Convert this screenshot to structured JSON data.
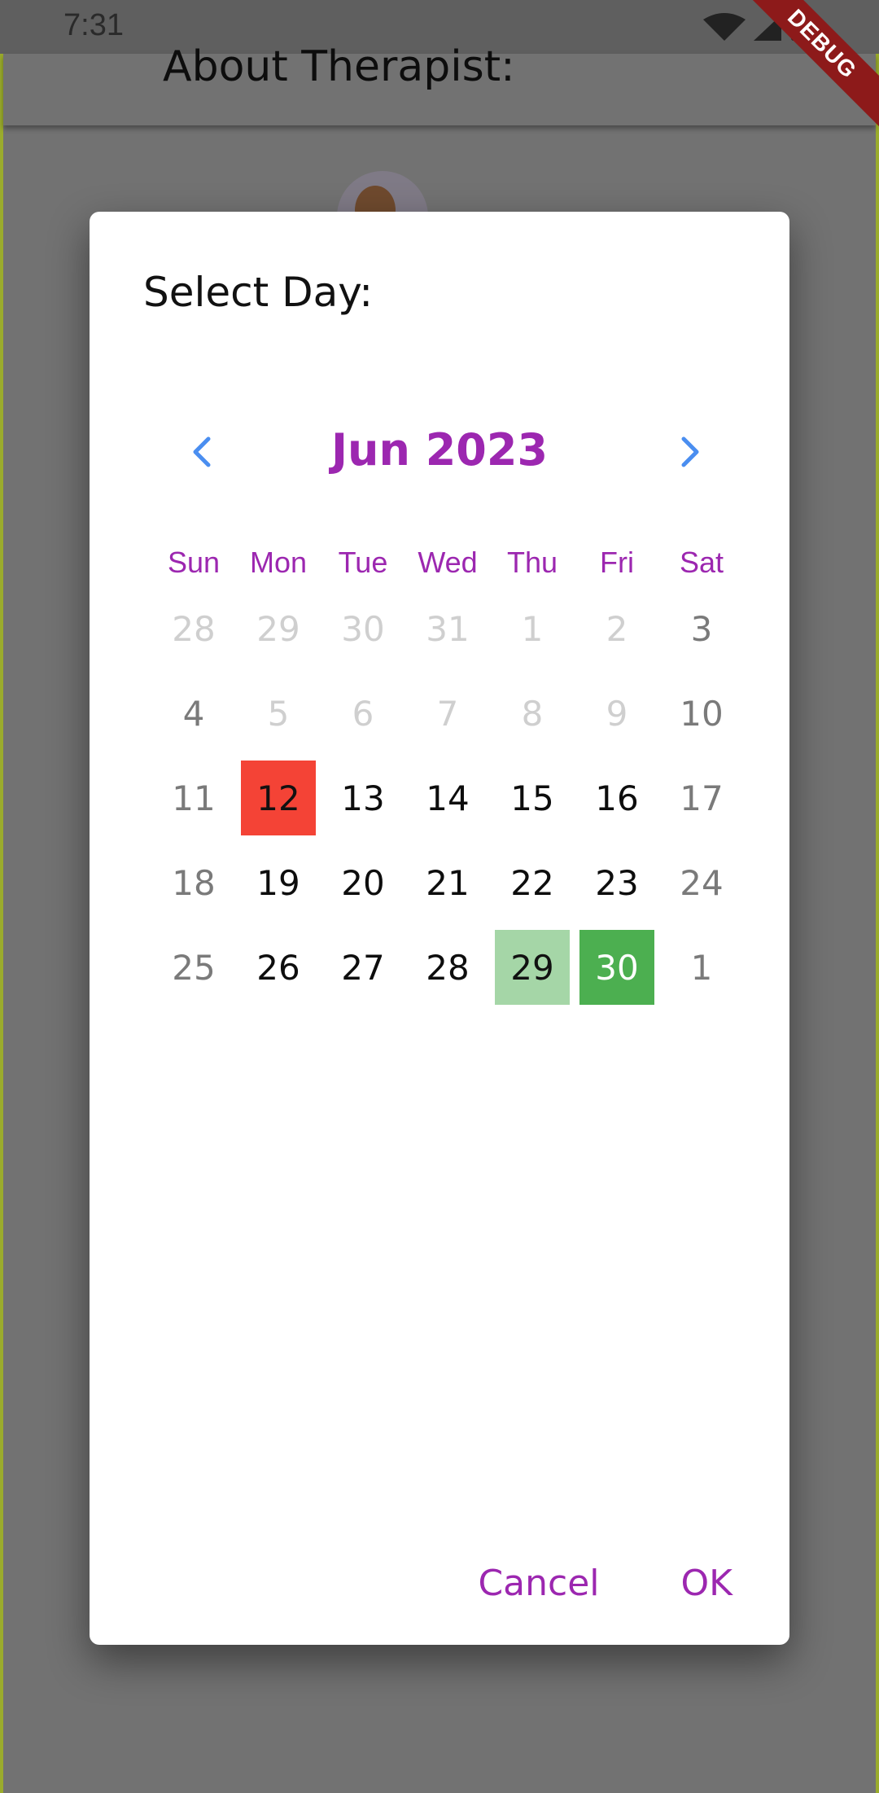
{
  "status_bar": {
    "time": "7:31"
  },
  "app_bar": {
    "title": "About Therapist:"
  },
  "debug_banner": "DEBUG",
  "dialog": {
    "title": "Select Day:",
    "month": "Jun 2023",
    "days_of_week": [
      "Sun",
      "Mon",
      "Tue",
      "Wed",
      "Thu",
      "Fri",
      "Sat"
    ],
    "weeks": [
      [
        {
          "d": "28",
          "s": "muted"
        },
        {
          "d": "29",
          "s": "muted"
        },
        {
          "d": "30",
          "s": "muted"
        },
        {
          "d": "31",
          "s": "muted"
        },
        {
          "d": "1",
          "s": "muted"
        },
        {
          "d": "2",
          "s": "muted"
        },
        {
          "d": "3",
          "s": "weekend"
        }
      ],
      [
        {
          "d": "4",
          "s": "weekend"
        },
        {
          "d": "5",
          "s": "muted"
        },
        {
          "d": "6",
          "s": "muted"
        },
        {
          "d": "7",
          "s": "muted"
        },
        {
          "d": "8",
          "s": "muted"
        },
        {
          "d": "9",
          "s": "muted"
        },
        {
          "d": "10",
          "s": "weekend"
        }
      ],
      [
        {
          "d": "11",
          "s": "weekend"
        },
        {
          "d": "12",
          "s": "today"
        },
        {
          "d": "13",
          "s": "active"
        },
        {
          "d": "14",
          "s": "active"
        },
        {
          "d": "15",
          "s": "active"
        },
        {
          "d": "16",
          "s": "active"
        },
        {
          "d": "17",
          "s": "weekend"
        }
      ],
      [
        {
          "d": "18",
          "s": "weekend"
        },
        {
          "d": "19",
          "s": "active"
        },
        {
          "d": "20",
          "s": "active"
        },
        {
          "d": "21",
          "s": "active"
        },
        {
          "d": "22",
          "s": "active"
        },
        {
          "d": "23",
          "s": "active"
        },
        {
          "d": "24",
          "s": "weekend"
        }
      ],
      [
        {
          "d": "25",
          "s": "weekend"
        },
        {
          "d": "26",
          "s": "active"
        },
        {
          "d": "27",
          "s": "active"
        },
        {
          "d": "28",
          "s": "active"
        },
        {
          "d": "29",
          "s": "range"
        },
        {
          "d": "30",
          "s": "selected"
        },
        {
          "d": "1",
          "s": "weekend"
        }
      ]
    ],
    "cancel_label": "Cancel",
    "ok_label": "OK"
  },
  "colors": {
    "accent": "#9c27b0",
    "nav_arrow": "#4a8ef0",
    "today": "#f44336",
    "selected": "#4caf50",
    "range": "#a5d6a7"
  }
}
